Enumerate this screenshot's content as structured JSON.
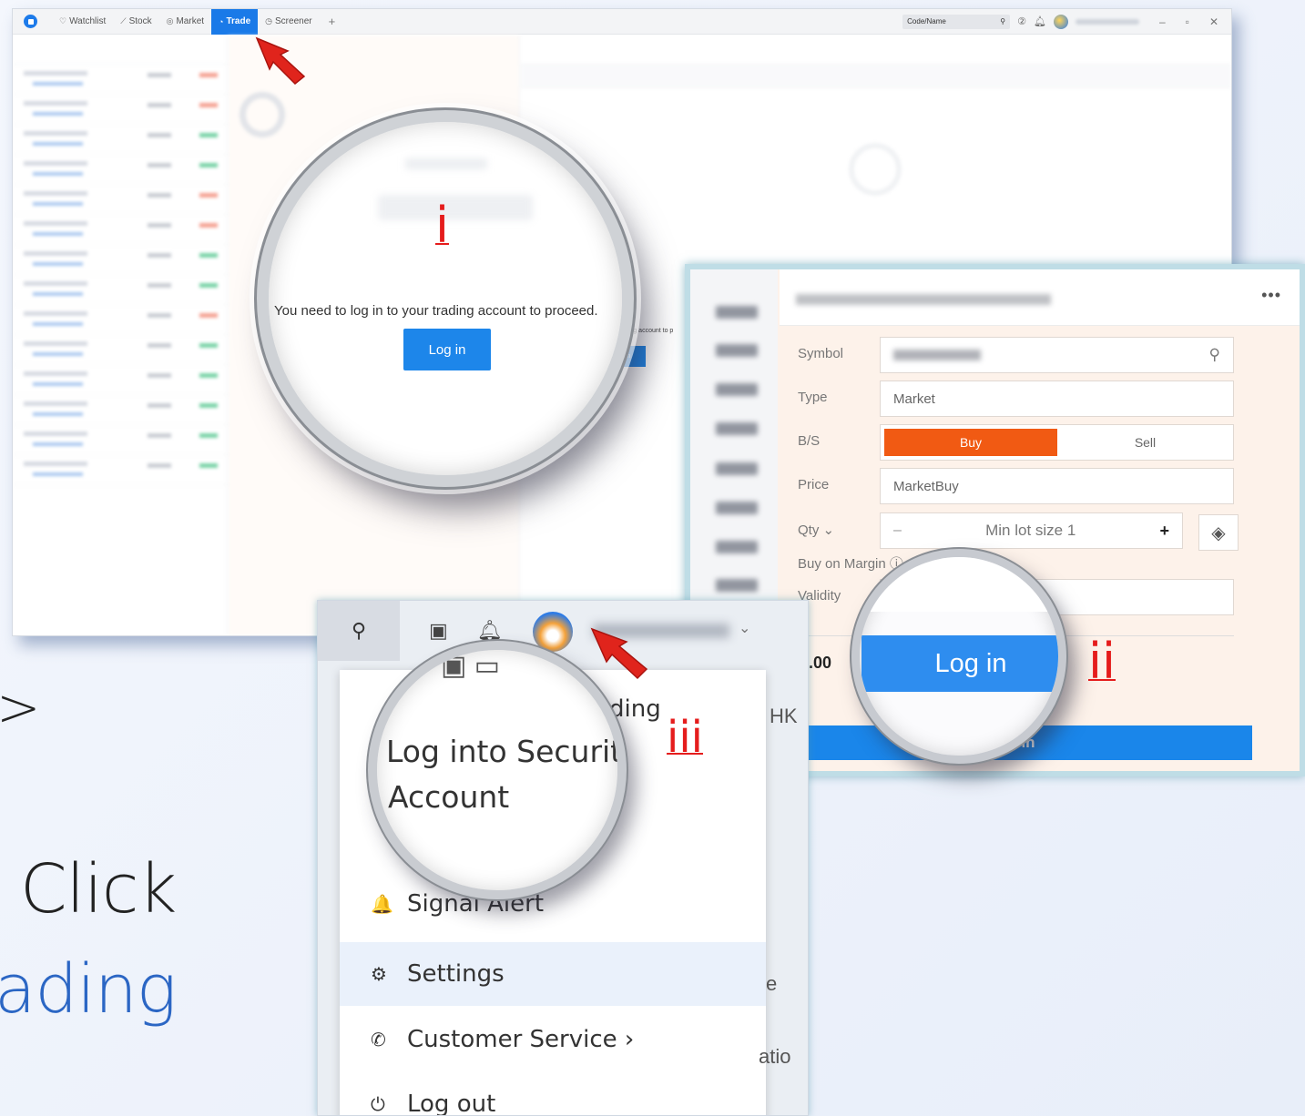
{
  "slide": {
    "chevron": ">",
    "click_text": "Click",
    "trading_text": "ading"
  },
  "app": {
    "tabs": [
      {
        "icon": "♡",
        "label": "Watchlist"
      },
      {
        "icon": "⟋",
        "label": "Stock"
      },
      {
        "icon": "◎",
        "label": "Market"
      },
      {
        "icon": "◔",
        "label": "Trade"
      },
      {
        "icon": "◷",
        "label": "Screener"
      }
    ],
    "add_tab": "+",
    "search_placeholder": "Code/Name",
    "window_controls": [
      "–",
      "▫",
      "✕"
    ],
    "behind_message": "ding account to p",
    "behind_button": "in"
  },
  "callout_i": {
    "label": "i",
    "message": "You need to log in to your trading account to proceed.",
    "button": "Log in"
  },
  "order": {
    "more": "•••",
    "symbol_label": "Symbol",
    "type_label": "Type",
    "type_value": "Market",
    "bs_label": "B/S",
    "buy": "Buy",
    "sell": "Sell",
    "price_label": "Price",
    "price_value": "MarketBuy",
    "qty_label": "Qty ⌄",
    "qty_minus": "–",
    "qty_placeholder": "Min lot size 1",
    "qty_plus": "+",
    "margin_label": "Buy on Margin ⓘ",
    "validity_label": "Validity",
    "amount": ".00",
    "login_bar": "in"
  },
  "callout_ii": {
    "label": "ii",
    "button": "Log in"
  },
  "menu": {
    "trading_fragment": "ding",
    "side_hk": "HK",
    "side_e": "e",
    "side_atio": "atio",
    "items": [
      {
        "icon": "🔔",
        "label": "Signal Alert"
      },
      {
        "icon": "⚙",
        "label": "Settings"
      },
      {
        "icon": "✆",
        "label": "Customer Service ›"
      },
      {
        "icon": "⏻",
        "label": "Log out"
      }
    ]
  },
  "callout_iii": {
    "label": "iii",
    "line1": "Log into Securitie",
    "line2": "Account"
  }
}
